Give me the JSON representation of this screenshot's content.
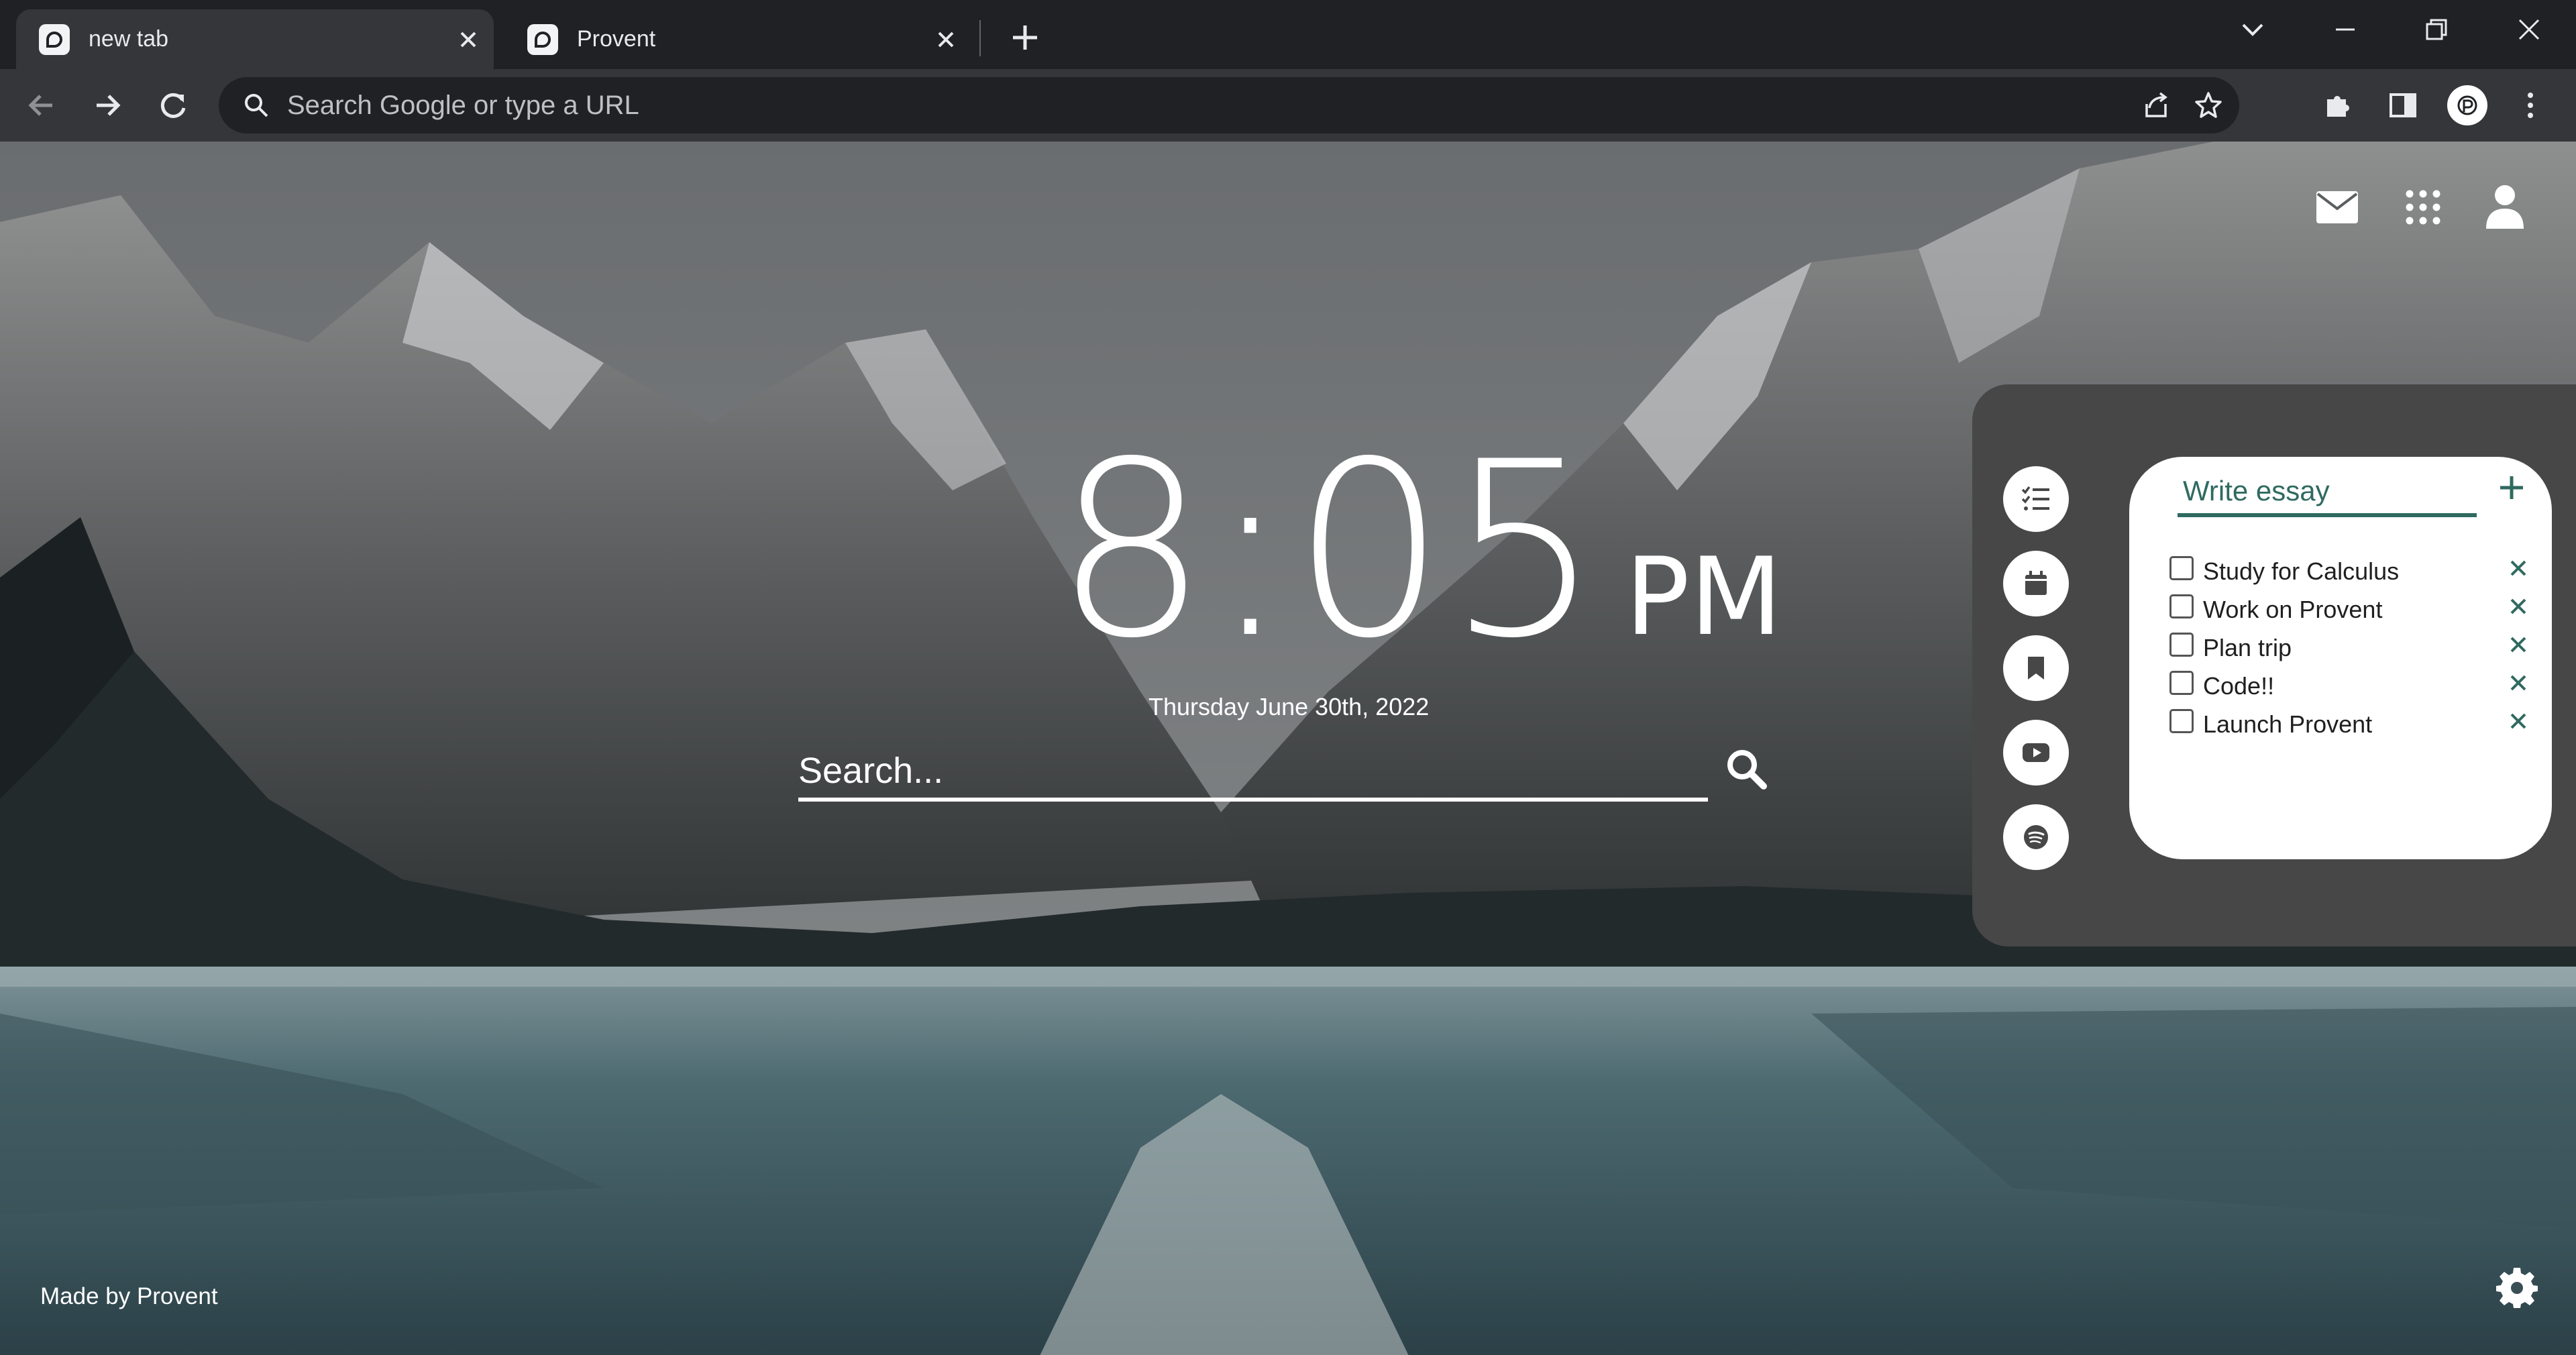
{
  "tabs": [
    {
      "title": "new tab",
      "active": true,
      "favicon": "provent-icon"
    },
    {
      "title": "Provent",
      "active": false,
      "favicon": "provent-icon"
    }
  ],
  "omnibox": {
    "placeholder": "Search Google or type a URL"
  },
  "clock": {
    "time": "8:05",
    "ampm": "PM"
  },
  "date": "Thursday June 30th, 2022",
  "search": {
    "placeholder": "Search..."
  },
  "panel_nav": [
    "todo-list-icon",
    "calendar-icon",
    "bookmark-icon",
    "youtube-icon",
    "spotify-icon"
  ],
  "todo": {
    "input_value": "Write essay",
    "items": [
      {
        "label": "Study for Calculus",
        "done": false
      },
      {
        "label": "Work on Provent",
        "done": false
      },
      {
        "label": "Plan trip",
        "done": false
      },
      {
        "label": "Code!!",
        "done": false
      },
      {
        "label": "Launch Provent",
        "done": false
      }
    ]
  },
  "footer": {
    "credit": "Made by Provent"
  },
  "colors": {
    "accent": "#2f6a60",
    "panel_bg": "#474747",
    "chrome_dark": "#202124",
    "chrome_toolbar": "#35363a"
  }
}
